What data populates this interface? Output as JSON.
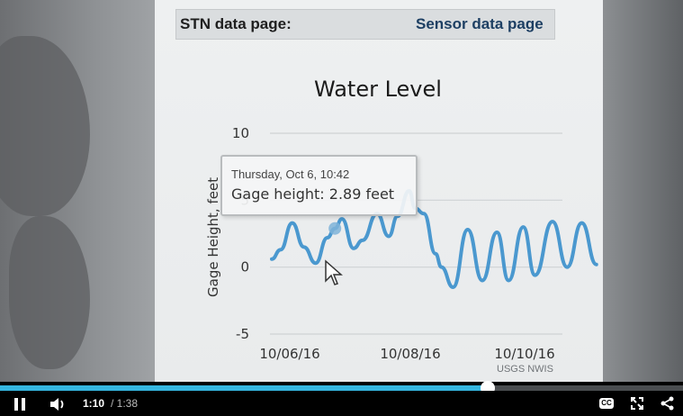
{
  "page": {
    "stn_label": "STN data page:",
    "sensor_link": "Sensor data page",
    "credit": "USGS NWIS"
  },
  "tooltip": {
    "date": "Thursday, Oct 6, 10:42",
    "value": "Gage height: 2.89 feet"
  },
  "chart_data": {
    "type": "line",
    "title": "Water Level",
    "xlabel": "",
    "ylabel": "Gage Height, feet",
    "x_ticks": [
      "10/06/16",
      "10/08/16",
      "10/10/16"
    ],
    "y_ticks": [
      10,
      5,
      0,
      -5
    ],
    "ylim": [
      -5,
      10
    ],
    "grid": true,
    "series": [
      {
        "color": "#4a98cf",
        "points": [
          [
            0.0,
            0.6
          ],
          [
            0.15,
            1.3
          ],
          [
            0.35,
            3.3
          ],
          [
            0.55,
            1.5
          ],
          [
            0.75,
            0.3
          ],
          [
            0.95,
            2.2
          ],
          [
            1.08,
            2.89
          ],
          [
            1.2,
            3.6
          ],
          [
            1.4,
            1.4
          ],
          [
            1.55,
            2.0
          ],
          [
            1.8,
            4.0
          ],
          [
            2.0,
            2.3
          ],
          [
            2.15,
            3.8
          ],
          [
            2.35,
            5.7
          ],
          [
            2.45,
            4.4
          ],
          [
            2.6,
            4.0
          ],
          [
            2.8,
            1.0
          ],
          [
            2.9,
            0.0
          ],
          [
            3.1,
            -1.5
          ],
          [
            3.35,
            2.8
          ],
          [
            3.6,
            -1.0
          ],
          [
            3.85,
            2.6
          ],
          [
            4.05,
            -1.0
          ],
          [
            4.3,
            3.0
          ],
          [
            4.5,
            -0.6
          ],
          [
            4.8,
            3.4
          ],
          [
            5.05,
            0.0
          ],
          [
            5.3,
            3.3
          ],
          [
            5.55,
            0.2
          ]
        ]
      }
    ]
  },
  "player": {
    "time_current": "1:10",
    "time_total": "/ 1:38",
    "progress": 0.714,
    "cc_label": "CC",
    "accent": "#35b6e0"
  }
}
